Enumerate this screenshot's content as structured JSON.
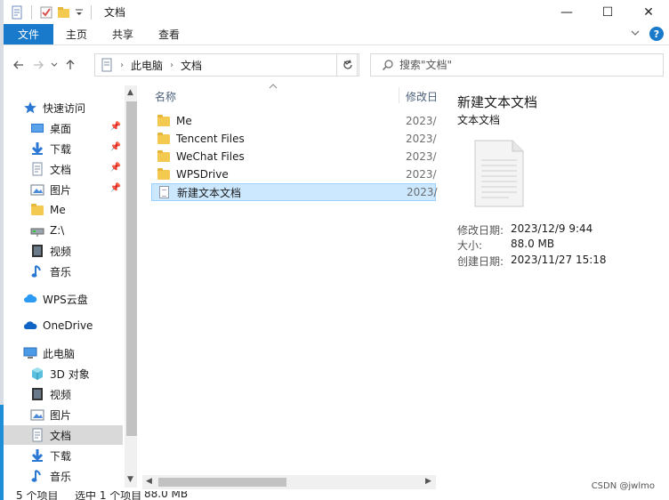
{
  "window": {
    "title": "文档",
    "controls": {
      "minimize": "—",
      "maximize": "☐",
      "close": "✕"
    }
  },
  "ribbon": {
    "tabs": [
      "文件",
      "主页",
      "共享",
      "查看"
    ],
    "expand_icon": "chevron-down",
    "help_label": "?"
  },
  "address": {
    "crumbs": [
      "此电脑",
      "文档"
    ]
  },
  "search": {
    "placeholder": "搜索\"文档\""
  },
  "nav": {
    "items": [
      {
        "label": "快速访问",
        "icon": "star-icon"
      },
      {
        "label": "桌面",
        "icon": "desktop-icon",
        "pinned": true
      },
      {
        "label": "下载",
        "icon": "download-icon",
        "pinned": true
      },
      {
        "label": "文档",
        "icon": "document-icon",
        "pinned": true
      },
      {
        "label": "图片",
        "icon": "pictures-icon",
        "pinned": true
      },
      {
        "label": "Me",
        "icon": "folder-icon"
      },
      {
        "label": "Z:\\",
        "icon": "network-drive-icon"
      },
      {
        "label": "视频",
        "icon": "video-icon"
      },
      {
        "label": "音乐",
        "icon": "music-icon"
      },
      {
        "label": "WPS云盘",
        "icon": "cloud-icon"
      },
      {
        "label": "OneDrive",
        "icon": "onedrive-icon"
      },
      {
        "label": "此电脑",
        "icon": "computer-icon"
      },
      {
        "label": "3D 对象",
        "icon": "cube-icon"
      },
      {
        "label": "视频",
        "icon": "video-icon"
      },
      {
        "label": "图片",
        "icon": "pictures-icon"
      },
      {
        "label": "文档",
        "icon": "document-icon",
        "selected": true
      },
      {
        "label": "下载",
        "icon": "download-icon"
      },
      {
        "label": "音乐",
        "icon": "music-icon"
      }
    ]
  },
  "filelist": {
    "columns": {
      "name": "名称",
      "modified": "修改日"
    },
    "files": [
      {
        "name": "Me",
        "date": "2023/",
        "type": "folder"
      },
      {
        "name": "Tencent Files",
        "date": "2023/",
        "type": "folder"
      },
      {
        "name": "WeChat Files",
        "date": "2023/",
        "type": "folder"
      },
      {
        "name": "WPSDrive",
        "date": "2023/",
        "type": "folder"
      },
      {
        "name": "新建文本文档",
        "date": "2023/",
        "type": "document",
        "selected": true
      }
    ]
  },
  "details": {
    "title": "新建文本文档",
    "type": "文本文档",
    "modified_label": "修改日期:",
    "modified_value": "2023/12/9 9:44",
    "size_label": "大小:",
    "size_value": "88.0 MB",
    "created_label": "创建日期:",
    "created_value": "2023/11/27 15:18"
  },
  "status": {
    "count": "5 个项目",
    "selected": "选中 1 个项目",
    "size": "88.0 MB"
  },
  "watermark": "CSDN @jwlmo",
  "colors": {
    "accent": "#1979ca",
    "selection": "#cce8ff",
    "folder": "#f4c94f"
  }
}
